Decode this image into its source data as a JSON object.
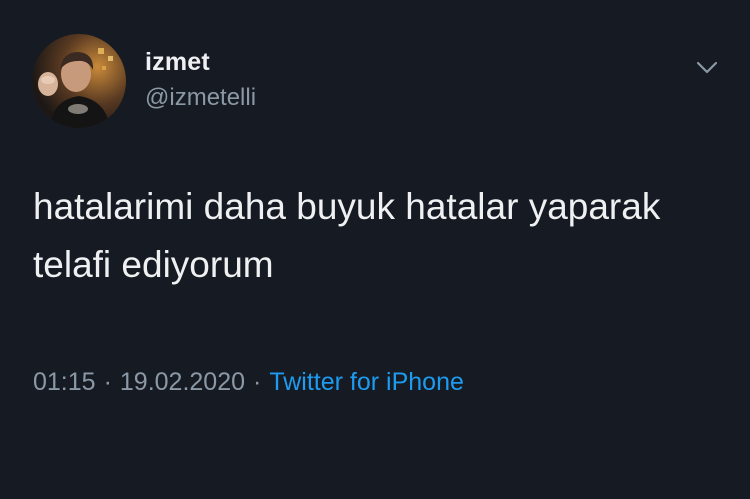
{
  "author": {
    "display_name": "izmet",
    "handle": "@izmetelli"
  },
  "tweet": {
    "line1": "hatalarimi daha buyuk hatalar yaparak",
    "line2": "telafi ediyorum"
  },
  "meta": {
    "time": "01:15",
    "date": "19.02.2020",
    "separator": "·",
    "source": "Twitter for iPhone"
  },
  "icons": {
    "menu": "chevron-down-icon",
    "avatar": "profile-photo"
  },
  "colors": {
    "background": "#161a22",
    "text": "#eef0f1",
    "secondary_text": "#8b98a5",
    "link": "#1d9bf0"
  }
}
